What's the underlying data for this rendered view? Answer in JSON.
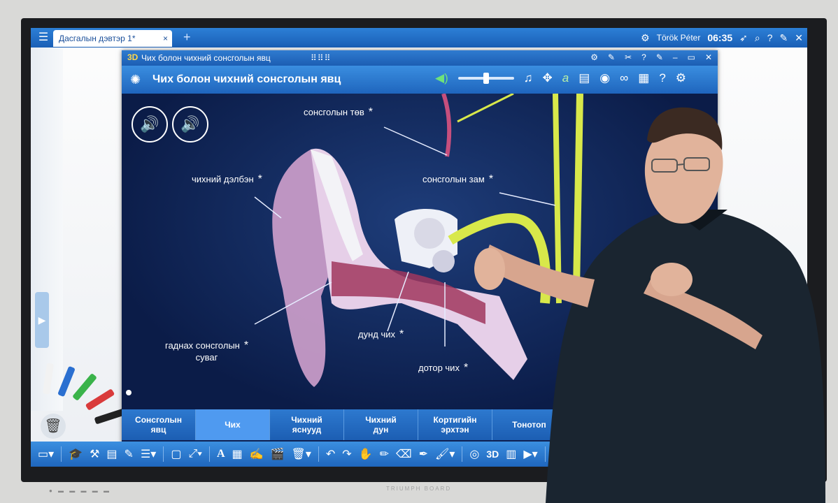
{
  "topbar": {
    "doc_tab": "Дасгалын дэвтэр 1*",
    "user": "Török Péter",
    "time": "06:35"
  },
  "window": {
    "title_small": "Чих болон чихний сонсголын явц",
    "badge": "3D",
    "app_title": "Чих болон чихний сонсголын явц"
  },
  "labels": {
    "sonsgol_tuv": "сонсголын төв",
    "chikhnii_delben": "чихний дэлбэн",
    "sonsgol_zam": "сонсголын зам",
    "gadnakh_1": "гаднах сонсголын",
    "gadnakh_2": "суваг",
    "dund_chikh": "дунд чих",
    "dotor_chikh": "дотор чих",
    "star": "*"
  },
  "tabs": [
    {
      "line1": "Сонсголын",
      "line2": "явц"
    },
    {
      "line1": "Чих",
      "line2": ""
    },
    {
      "line1": "Чихний",
      "line2": "яснууд"
    },
    {
      "line1": "Чихний",
      "line2": "дун"
    },
    {
      "line1": "Кортигийн",
      "line2": "эрхтэн"
    },
    {
      "line1": "Тонотоп",
      "line2": ""
    }
  ],
  "bottom": {
    "brand": "TRIUMPH BOARD"
  },
  "colors": {
    "accent": "#1f66bd",
    "scene_bg": "#0e2151",
    "active_tab": "#4f9af0"
  }
}
